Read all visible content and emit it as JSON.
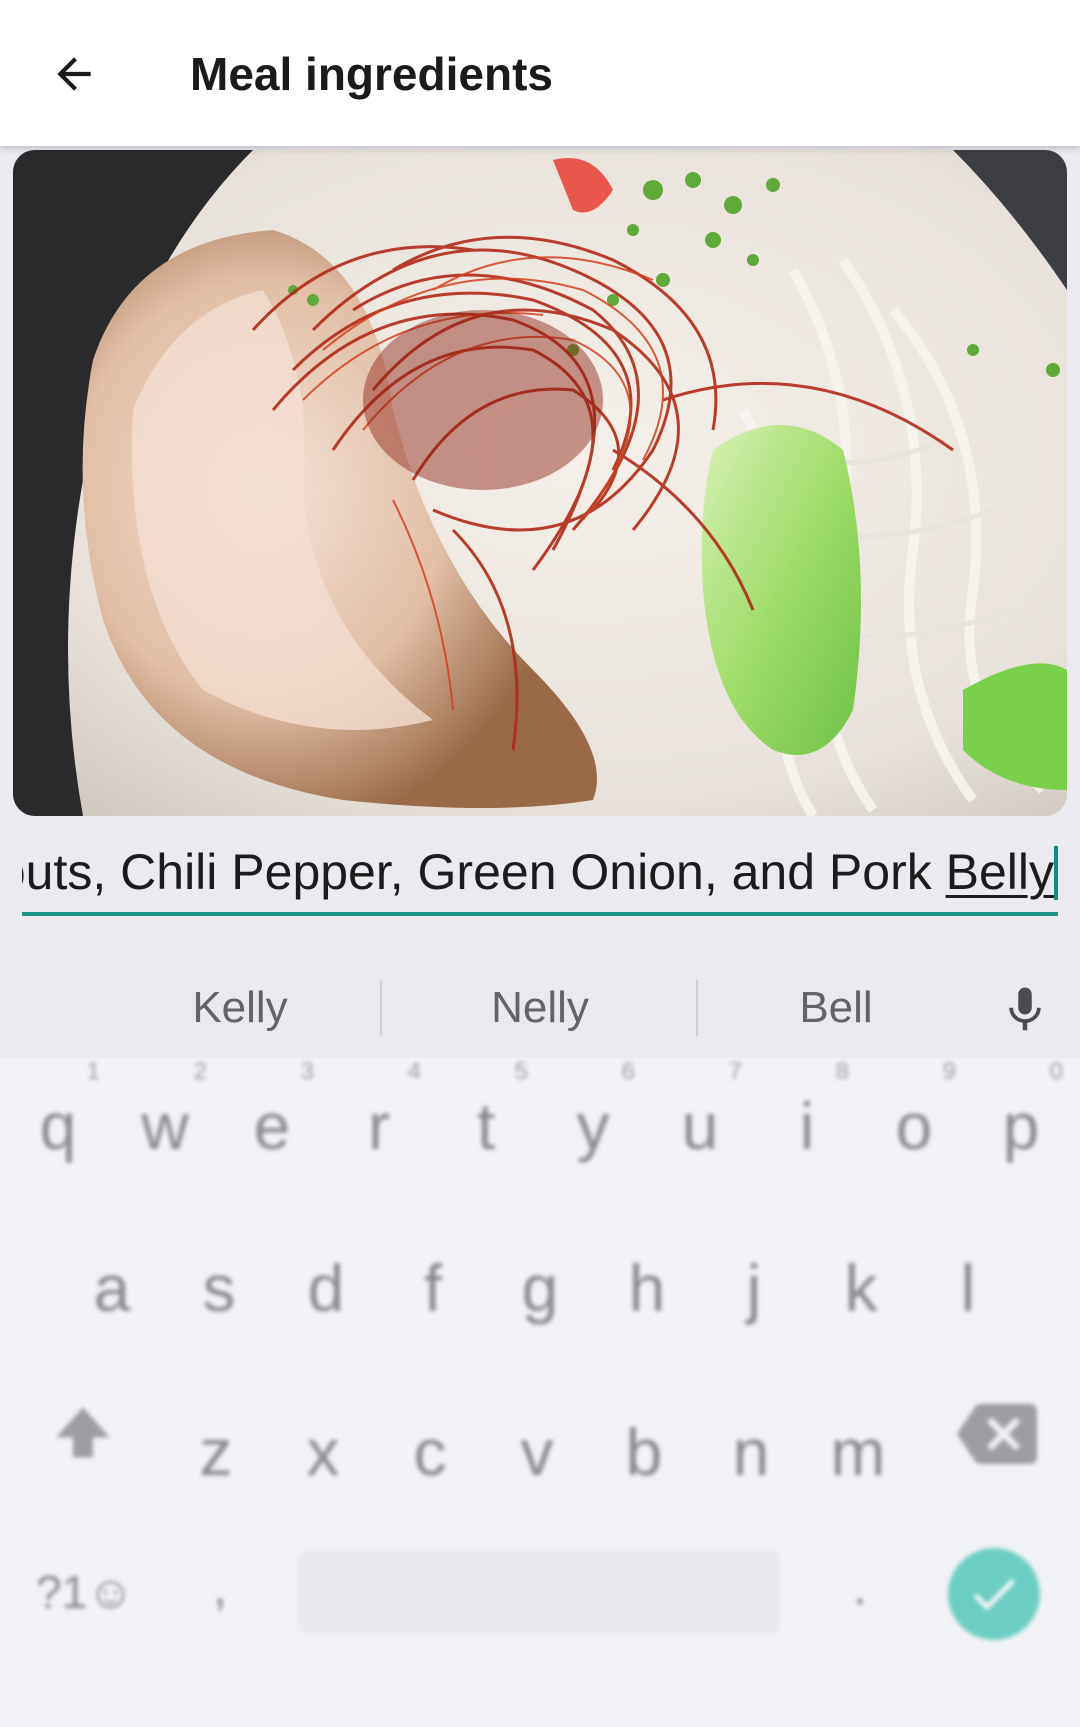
{
  "appbar": {
    "back_icon": "arrow-back-icon",
    "title": "Meal ingredients"
  },
  "photo": {
    "subject": "ramen-bowl-image"
  },
  "ingredients_field": {
    "value_before_composing": "Bean Sprouts, Chili Pepper, Green Onion, and Pork ",
    "composing_word": "Belly",
    "accent_color": "#1b9386"
  },
  "keyboard": {
    "suggestions": [
      "Kelly",
      "Nelly",
      "Bell"
    ],
    "mic_icon": "microphone-icon",
    "row1": [
      {
        "key": "q",
        "hint": "1"
      },
      {
        "key": "w",
        "hint": "2"
      },
      {
        "key": "e",
        "hint": "3"
      },
      {
        "key": "r",
        "hint": "4"
      },
      {
        "key": "t",
        "hint": "5"
      },
      {
        "key": "y",
        "hint": "6"
      },
      {
        "key": "u",
        "hint": "7"
      },
      {
        "key": "i",
        "hint": "8"
      },
      {
        "key": "o",
        "hint": "9"
      },
      {
        "key": "p",
        "hint": "0"
      }
    ],
    "row2": [
      "a",
      "s",
      "d",
      "f",
      "g",
      "h",
      "j",
      "k",
      "l"
    ],
    "row3": [
      "z",
      "x",
      "c",
      "v",
      "b",
      "n",
      "m"
    ],
    "symbols_label": "?1☺",
    "comma": ",",
    "period": ".",
    "enter_color": "#1cb8a5",
    "enter_icon": "checkmark-icon",
    "shift_icon": "shift-icon",
    "backspace_icon": "backspace-icon"
  }
}
